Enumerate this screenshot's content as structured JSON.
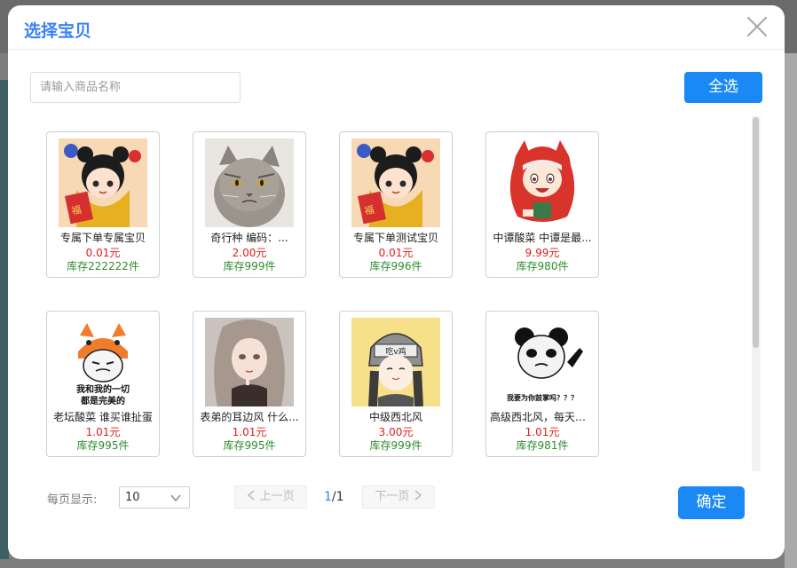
{
  "modal": {
    "title": "选择宝贝"
  },
  "search": {
    "placeholder": "请输入商品名称",
    "value": ""
  },
  "select_all_label": "全选",
  "products": [
    {
      "name": "专属下单专属宝贝",
      "price": "0.01元",
      "stock": "库存222222件",
      "image": "girl-new-year-illustration"
    },
    {
      "name": "奇行种 编码：...",
      "price": "2.00元",
      "stock": "库存999件",
      "image": "grumpy-cat-photo"
    },
    {
      "name": "专属下单测试宝贝",
      "price": "0.01元",
      "stock": "库存996件",
      "image": "girl-new-year-illustration"
    },
    {
      "name": "中谭酸菜 中谭是最...",
      "price": "9.99元",
      "stock": "库存980件",
      "image": "anime-girl-red-hood"
    },
    {
      "name": "老坛酸菜 谁买谁扯蛋",
      "price": "1.01元",
      "stock": "库存995件",
      "image": "meme-cat-hat-face"
    },
    {
      "name": "表弟的耳边风 什么...",
      "price": "1.01元",
      "stock": "库存995件",
      "image": "anime-girl-long-hair"
    },
    {
      "name": "中级西北风",
      "price": "3.00元",
      "stock": "库存999件",
      "image": "anime-girl-helmet"
    },
    {
      "name": "高级西北风，每天喝...",
      "price": "1.01元",
      "stock": "库存981件",
      "image": "panda-meme"
    }
  ],
  "meme_text": {
    "cat_hat_line1": "我和我的一切",
    "cat_hat_line2": "都是完美的",
    "panda_caption": "我要为你鼓掌吗？？？",
    "helmet_text": "吃v鸡"
  },
  "pagination": {
    "per_page_label": "每页显示:",
    "per_page_value": "10",
    "prev_label": "上一页",
    "next_label": "下一页",
    "current_page": "1",
    "separator": "/",
    "total_pages": "1"
  },
  "confirm_label": "确定",
  "colors": {
    "accent": "#1a88f5",
    "title": "#3b82f6",
    "price": "#e0201c",
    "stock": "#2e8b2e"
  }
}
